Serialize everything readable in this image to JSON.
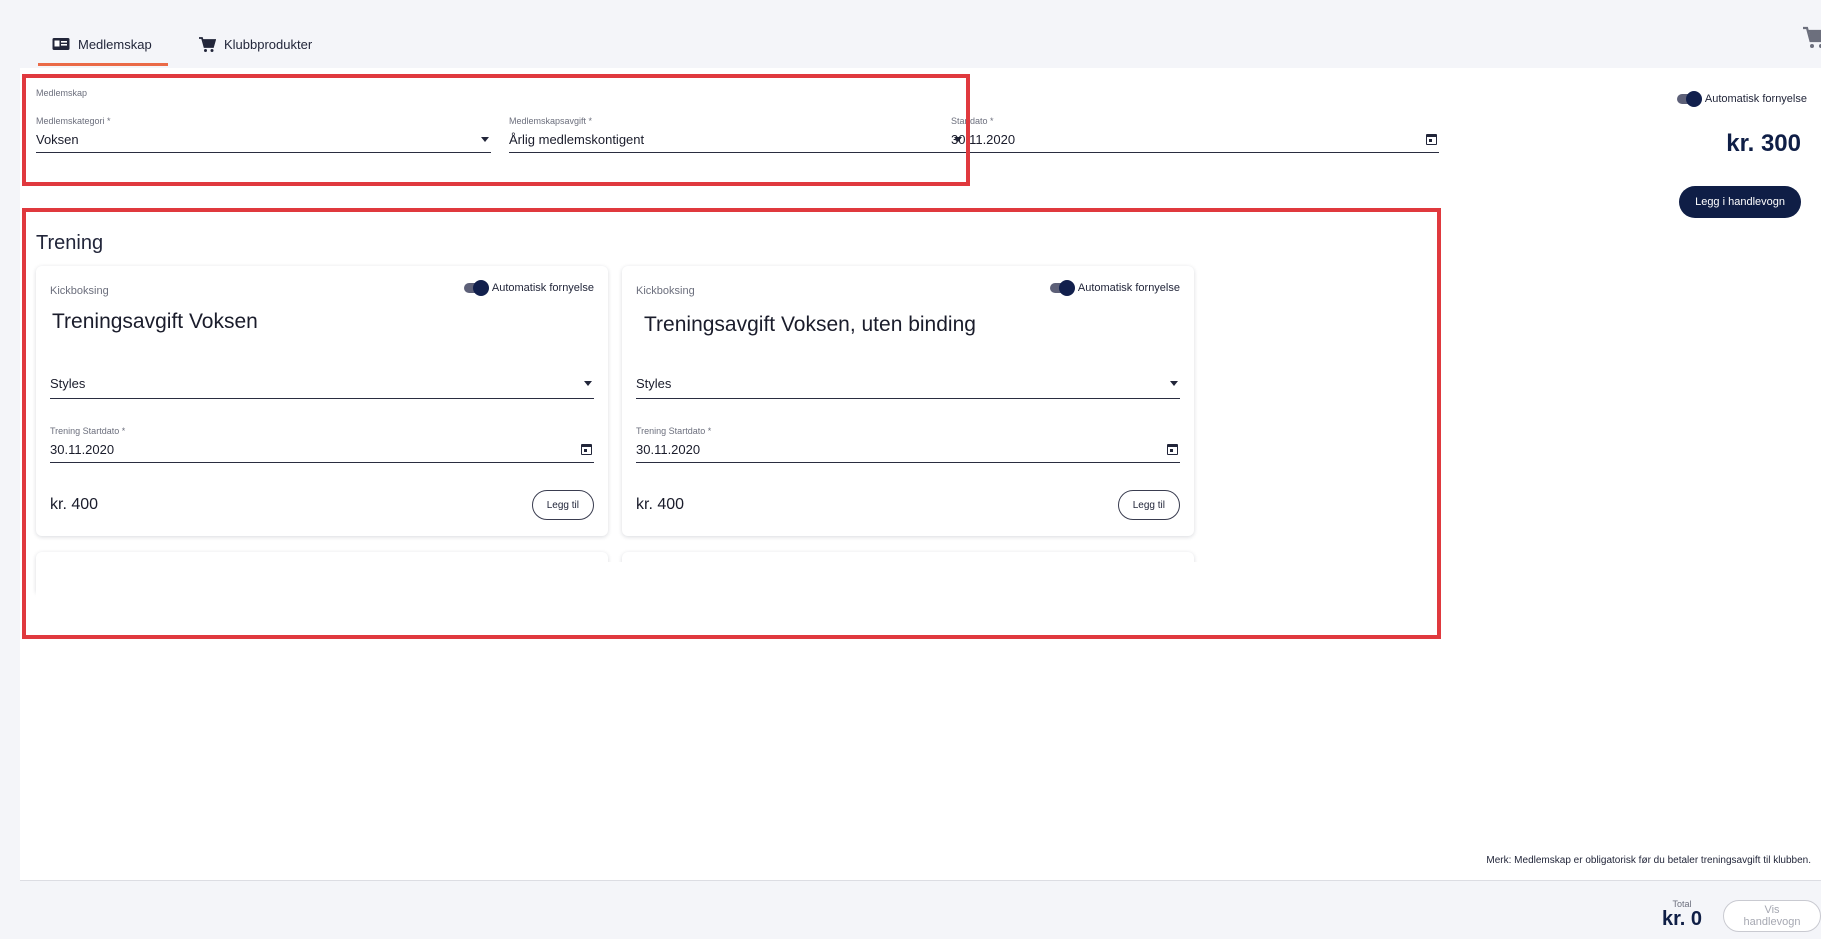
{
  "tabs": [
    {
      "label": "Medlemskap",
      "icon": "id-card-icon",
      "active": true
    },
    {
      "label": "Klubbprodukter",
      "icon": "cart-icon",
      "active": false
    }
  ],
  "membership": {
    "section_label": "Medlemskap",
    "category": {
      "label": "Medlemskategori *",
      "value": "Voksen"
    },
    "fee": {
      "label": "Medlemskapsavgift *",
      "value": "Årlig medlemskontigent"
    },
    "start": {
      "label": "Startdato *",
      "value": "30.11.2020"
    },
    "auto_renew": {
      "label": "Automatisk fornyelse",
      "on": true
    },
    "price": "kr. 300",
    "add_button": "Legg i handlevogn"
  },
  "training": {
    "title": "Trening",
    "cards": [
      {
        "category": "Kickboksing",
        "auto_renew": "Automatisk fornyelse",
        "title": "Treningsavgift Voksen",
        "styles_label": "Styles",
        "start_label": "Trening Startdato *",
        "start_value": "30.11.2020",
        "price": "kr. 400",
        "button": "Legg til"
      },
      {
        "category": "Kickboksing",
        "auto_renew": "Automatisk fornyelse",
        "title": "Treningsavgift Voksen, uten binding",
        "styles_label": "Styles",
        "start_label": "Trening Startdato *",
        "start_value": "30.11.2020",
        "price": "kr. 400",
        "button": "Legg til"
      }
    ]
  },
  "footer": {
    "note": "Merk: Medlemskap er obligatorisk før du betaler treningsavgift til klubben.",
    "total_label": "Total",
    "total_value": "kr. 0",
    "cart_button": "Vis handlevogn"
  },
  "colors": {
    "accent": "#ea6a47",
    "primary": "#0f1e46",
    "highlight": "#e0393e"
  }
}
